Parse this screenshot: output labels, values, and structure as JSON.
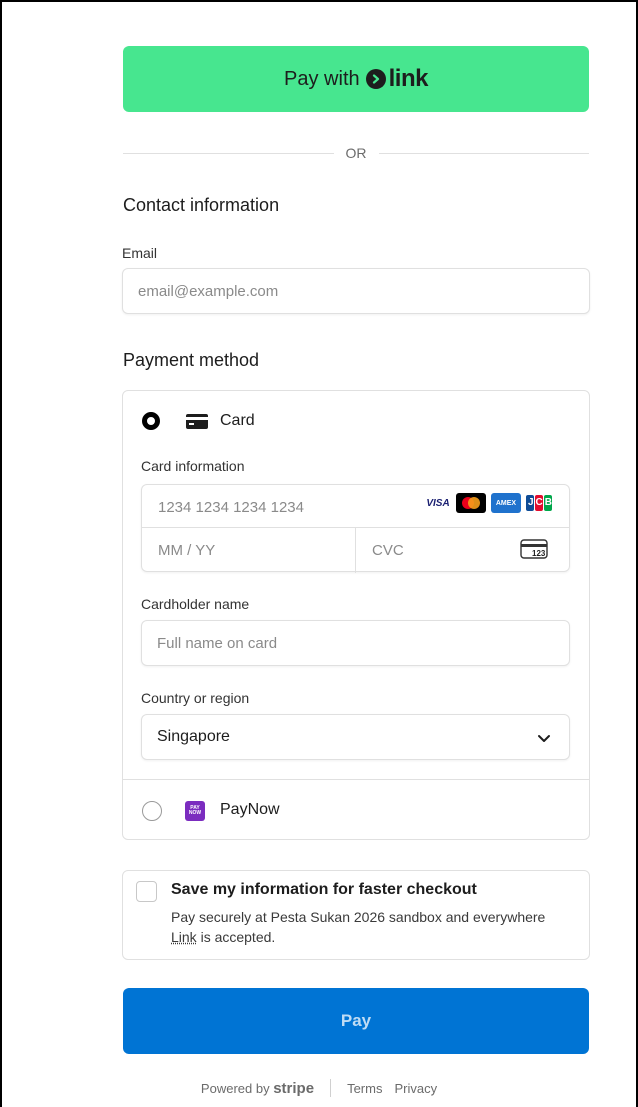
{
  "link_button": {
    "prefix": "Pay with",
    "brand": "link"
  },
  "divider": {
    "text": "OR"
  },
  "contact": {
    "title": "Contact information",
    "email_label": "Email",
    "email_placeholder": "email@example.com"
  },
  "payment": {
    "title": "Payment method",
    "card_option": {
      "label": "Card",
      "selected": true
    },
    "card_info_label": "Card information",
    "card_number_placeholder": "1234 1234 1234 1234",
    "expiry_placeholder": "MM / YY",
    "cvc_placeholder": "CVC",
    "cvc_icon_text": "123",
    "brands": [
      {
        "name": "VISA",
        "color": "#1a1f71"
      },
      {
        "name": "mastercard",
        "color": "#000000"
      },
      {
        "name": "AMEX",
        "color": "#1f72cd"
      },
      {
        "name": "JCB",
        "color": "#0e4c96"
      }
    ],
    "cardholder_label": "Cardholder name",
    "cardholder_placeholder": "Full name on card",
    "country_label": "Country or region",
    "country_value": "Singapore",
    "paynow_option": {
      "label": "PayNow",
      "logo_text": "PAY NOW",
      "selected": false,
      "logo_color": "#7b2cbf"
    }
  },
  "save_info": {
    "title": "Save my information for faster checkout",
    "desc_before": "Pay securely at Pesta Sukan 2026 sandbox and everywhere ",
    "desc_link": "Link",
    "desc_after": " is accepted."
  },
  "pay_button": {
    "label": "Pay",
    "color": "#0074d4"
  },
  "footer": {
    "powered_by": "Powered by",
    "brand": "stripe",
    "terms": "Terms",
    "privacy": "Privacy"
  },
  "colors": {
    "link_green": "#47e68f"
  }
}
